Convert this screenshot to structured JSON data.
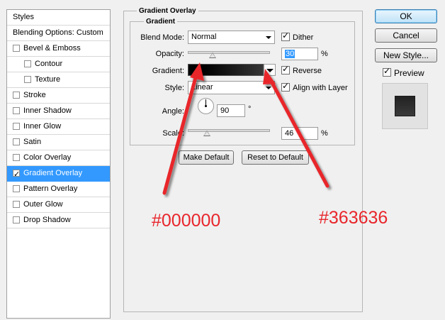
{
  "styles_panel": {
    "header": "Styles",
    "blending_options": "Blending Options: Custom",
    "items": [
      {
        "label": "Bevel & Emboss",
        "checked": false,
        "indent": false
      },
      {
        "label": "Contour",
        "checked": false,
        "indent": true
      },
      {
        "label": "Texture",
        "checked": false,
        "indent": true
      },
      {
        "label": "Stroke",
        "checked": false,
        "indent": false
      },
      {
        "label": "Inner Shadow",
        "checked": false,
        "indent": false
      },
      {
        "label": "Inner Glow",
        "checked": false,
        "indent": false
      },
      {
        "label": "Satin",
        "checked": false,
        "indent": false
      },
      {
        "label": "Color Overlay",
        "checked": false,
        "indent": false
      },
      {
        "label": "Gradient Overlay",
        "checked": true,
        "indent": false,
        "selected": true
      },
      {
        "label": "Pattern Overlay",
        "checked": false,
        "indent": false
      },
      {
        "label": "Outer Glow",
        "checked": false,
        "indent": false
      },
      {
        "label": "Drop Shadow",
        "checked": false,
        "indent": false
      }
    ]
  },
  "gradient_overlay": {
    "title": "Gradient Overlay",
    "subtitle": "Gradient",
    "blend_mode_label": "Blend Mode:",
    "blend_mode_value": "Normal",
    "dither_label": "Dither",
    "dither_checked": true,
    "opacity_label": "Opacity:",
    "opacity_value": "30",
    "opacity_unit": "%",
    "opacity_fraction": 0.3,
    "gradient_label": "Gradient:",
    "reverse_label": "Reverse",
    "reverse_checked": true,
    "style_label": "Style:",
    "style_value": "Linear",
    "align_label": "Align with Layer",
    "align_checked": true,
    "angle_label": "Angle:",
    "angle_value": "90",
    "angle_unit": "°",
    "scale_label": "Scale:",
    "scale_value": "46",
    "scale_unit": "%",
    "scale_fraction": 0.23,
    "make_default": "Make Default",
    "reset_default": "Reset to Default"
  },
  "right_panel": {
    "ok": "OK",
    "cancel": "Cancel",
    "new_style": "New Style...",
    "preview_label": "Preview",
    "preview_checked": true
  },
  "annotations": {
    "color_start": "#000000",
    "color_end": "#363636",
    "arrow_color": "#e8262c"
  },
  "colors": {
    "selection": "#3399ff",
    "gradient_start": "#000000",
    "gradient_end": "#363636"
  }
}
